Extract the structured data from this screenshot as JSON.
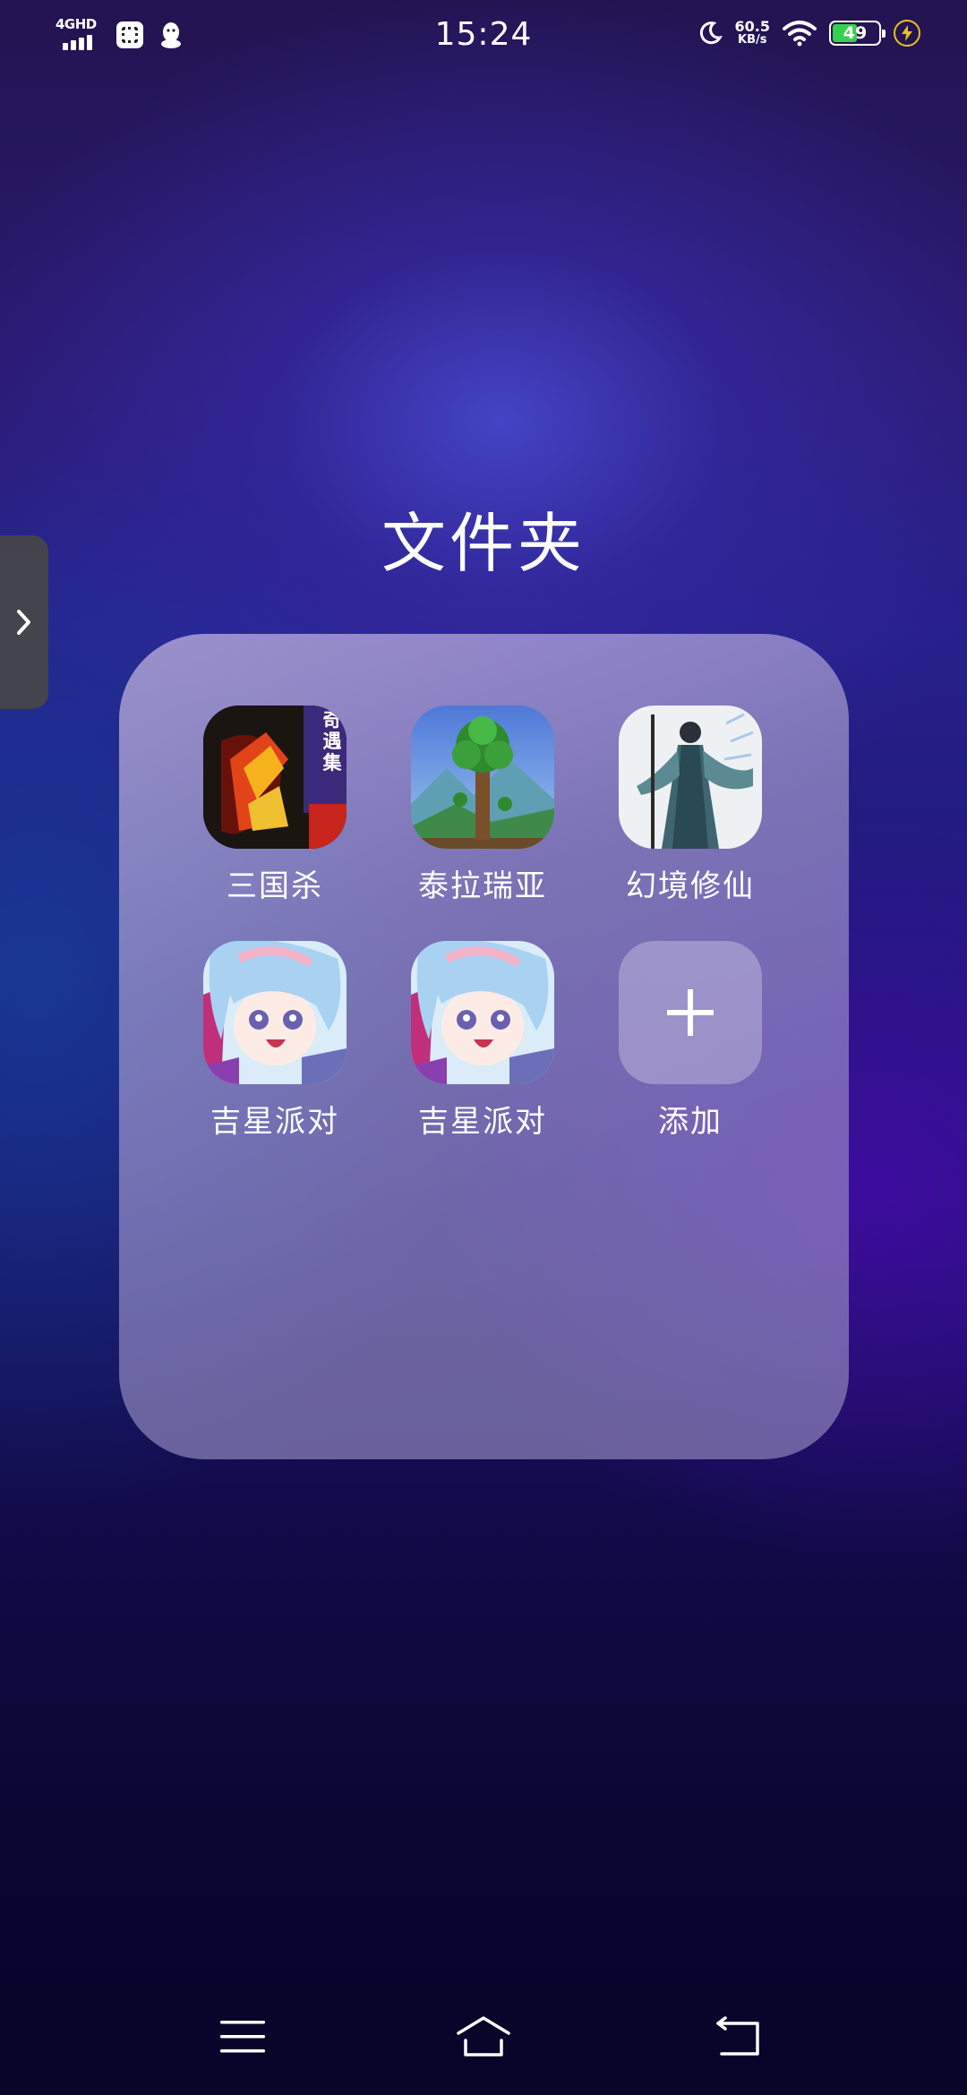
{
  "status_bar": {
    "network": "4GHD",
    "time": "15:24",
    "speed_value": "60.5",
    "speed_unit": "KB/s",
    "battery": "49",
    "icons": [
      "signal-icon",
      "app-notification-icon",
      "qq-icon",
      "moon-icon",
      "wifi-icon",
      "battery-icon",
      "charging-icon"
    ]
  },
  "folder": {
    "title": "文件夹",
    "apps": [
      {
        "label": "三国杀",
        "icon": "sanguosha-app-icon",
        "badge_text": "奇遇集"
      },
      {
        "label": "泰拉瑞亚",
        "icon": "terraria-app-icon"
      },
      {
        "label": "幻境修仙",
        "icon": "huanjing-xiuxian-app-icon"
      },
      {
        "label": "吉星派对",
        "icon": "jixing-paidui-app-icon"
      },
      {
        "label": "吉星派对",
        "icon": "jixing-paidui-app-icon"
      },
      {
        "label": "添加",
        "icon": "add-icon"
      }
    ]
  },
  "navigation": {
    "buttons": [
      "menu-icon",
      "home-icon",
      "back-icon"
    ]
  },
  "colors": {
    "battery_fill": "#35d04f",
    "charging": "#e6c21c",
    "text": "#ffffff"
  }
}
